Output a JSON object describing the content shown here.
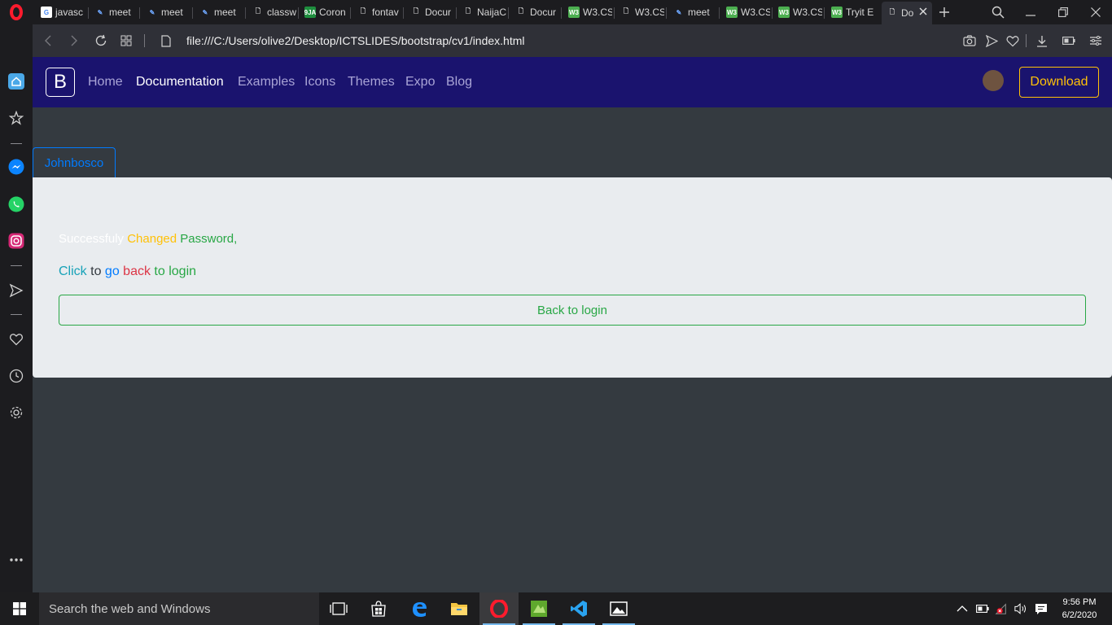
{
  "browser": {
    "tabs": [
      {
        "label": "javasc",
        "favicon": "google-icon"
      },
      {
        "label": "meet",
        "favicon": "meet-icon"
      },
      {
        "label": "meet",
        "favicon": "meet-icon"
      },
      {
        "label": "meet",
        "favicon": "meet-icon"
      },
      {
        "label": "classw",
        "favicon": "document-icon"
      },
      {
        "label": "Coron",
        "favicon": "9ja-icon",
        "badge": "9JA"
      },
      {
        "label": "fontav",
        "favicon": "document-icon"
      },
      {
        "label": "Docur",
        "favicon": "document-icon"
      },
      {
        "label": "NaijaC",
        "favicon": "document-icon"
      },
      {
        "label": "Docur",
        "favicon": "document-icon"
      },
      {
        "label": "W3.CS",
        "favicon": "w3-icon",
        "badge": "W3"
      },
      {
        "label": "W3.CS",
        "favicon": "document-icon"
      },
      {
        "label": "meet",
        "favicon": "meet-icon"
      },
      {
        "label": "W3.CS",
        "favicon": "w3-icon",
        "badge": "W3"
      },
      {
        "label": "W3.CS",
        "favicon": "w3-icon",
        "badge": "W3"
      },
      {
        "label": "Tryit E",
        "favicon": "w3-icon",
        "badge": "W3"
      },
      {
        "label": "Do",
        "favicon": "document-icon",
        "active": true
      }
    ],
    "url": "file:///C:/Users/olive2/Desktop/ICTSLIDES/bootstrap/cv1/index.html"
  },
  "navbar": {
    "brand": "B",
    "links": [
      "Home",
      "Documentation",
      "Examples",
      "Icons",
      "Themes",
      "Expo",
      "Blog"
    ],
    "active_link": "Documentation",
    "download_label": "Download"
  },
  "main": {
    "tab_label": "Johnbosco",
    "line1": {
      "w1": "Successfuly",
      "w2": "Changed",
      "w3": "Password,"
    },
    "line2": {
      "w1": "Click",
      "w2": "to",
      "w3": "go",
      "w4": "back",
      "w5": "to login"
    },
    "button_label": "Back to login"
  },
  "taskbar": {
    "search_placeholder": "Search the web and Windows",
    "time": "9:56 PM",
    "date": "6/2/2020"
  },
  "colors": {
    "navbar_bg": "#1a136e",
    "page_bg": "#343a40",
    "card_bg": "#e9ecef",
    "success": "#28a745",
    "warning": "#ffc107",
    "primary": "#007bff",
    "danger": "#dc3545",
    "info": "#17a2b8"
  }
}
